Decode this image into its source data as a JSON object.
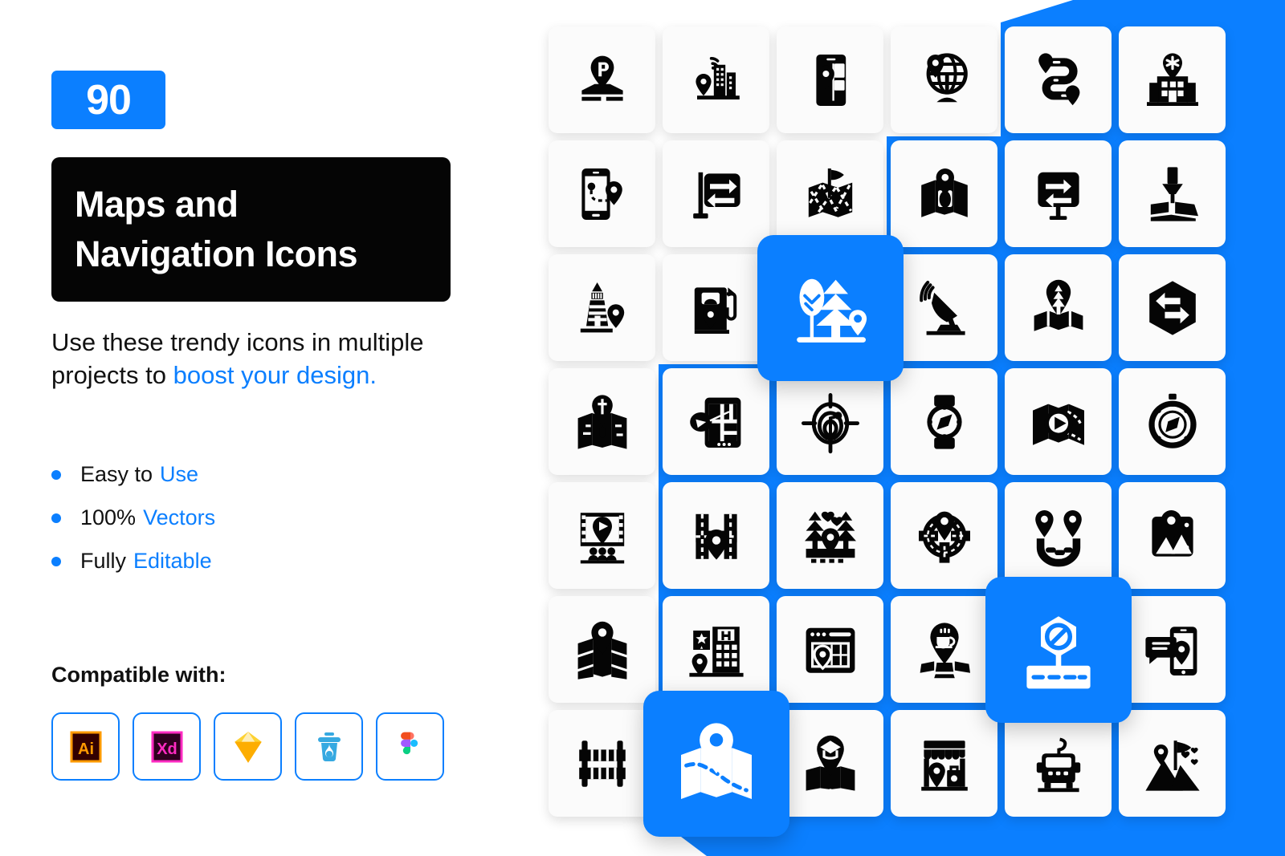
{
  "theme": {
    "accent": "#0b7fff",
    "dark": "#050505",
    "tile_bg": "#fbfbfb",
    "icon_color": "#050505",
    "page_bg": "#ffffff"
  },
  "left_panel": {
    "count_badge": "90",
    "title_lines": [
      "Maps and",
      "Navigation Icons"
    ],
    "description": {
      "part1": "Use these trendy icons in multiple projects to ",
      "highlight": "boost your design."
    },
    "bullets": [
      {
        "plain": "Easy to",
        "highlight": "Use"
      },
      {
        "plain": "100%",
        "highlight": "Vectors"
      },
      {
        "plain": "Fully",
        "highlight": "Editable"
      }
    ],
    "compatible_label": "Compatible with:",
    "compatible_apps": [
      {
        "name": "adobe-illustrator",
        "label": "Ai",
        "fg": "#ff9a00",
        "bg": "#330000"
      },
      {
        "name": "adobe-xd",
        "label": "Xd",
        "fg": "#ff2bc2",
        "bg": "#2e001f"
      },
      {
        "name": "sketch",
        "label": "",
        "fg": "#fdad00",
        "bg": "#ffffff"
      },
      {
        "name": "invision-studio",
        "label": "",
        "fg": "#36a9e1",
        "bg": "#ffffff"
      },
      {
        "name": "figma",
        "label": "",
        "fg": "#1abcfe",
        "bg": "#ffffff"
      }
    ]
  },
  "icon_grid": {
    "columns": 6,
    "rows": 7,
    "tiles": [
      {
        "row": 1,
        "col": 1,
        "icon": "parking-map-pin-icon",
        "label": "Parking on map"
      },
      {
        "row": 1,
        "col": 2,
        "icon": "city-signal-pin-icon",
        "label": "City location signal"
      },
      {
        "row": 1,
        "col": 3,
        "icon": "mobile-map-pin-icon",
        "label": "Mobile map pin"
      },
      {
        "row": 1,
        "col": 4,
        "icon": "globe-pin-icon",
        "label": "Globe with pin"
      },
      {
        "row": 1,
        "col": 5,
        "icon": "winding-route-icon",
        "label": "Winding route"
      },
      {
        "row": 1,
        "col": 6,
        "icon": "hospital-pin-icon",
        "label": "Hospital location"
      },
      {
        "row": 2,
        "col": 1,
        "icon": "phone-route-pin-icon",
        "label": "Phone navigation route"
      },
      {
        "row": 2,
        "col": 2,
        "icon": "two-way-signpost-icon",
        "label": "Two-way signpost"
      },
      {
        "row": 2,
        "col": 3,
        "icon": "flag-street-map-icon",
        "label": "Flag on street map"
      },
      {
        "row": 2,
        "col": 4,
        "icon": "map-pin-folded-icon",
        "label": "Folded map pin"
      },
      {
        "row": 2,
        "col": 5,
        "icon": "two-way-sign-board-icon",
        "label": "Two-way sign board"
      },
      {
        "row": 2,
        "col": 6,
        "icon": "pushpin-map-icon",
        "label": "Push pin on map"
      },
      {
        "row": 3,
        "col": 1,
        "icon": "lighthouse-pin-icon",
        "label": "Lighthouse location"
      },
      {
        "row": 3,
        "col": 2,
        "icon": "gas-station-pin-icon",
        "label": "Gas station location"
      },
      {
        "row": 3,
        "col": 3,
        "icon": "park-trees-pin-icon",
        "label": "Park location",
        "featured": true
      },
      {
        "row": 3,
        "col": 4,
        "icon": "satellite-dish-icon",
        "label": "Satellite dish"
      },
      {
        "row": 3,
        "col": 5,
        "icon": "forest-map-pin-icon",
        "label": "Forest on map"
      },
      {
        "row": 3,
        "col": 6,
        "icon": "two-way-arrow-hex-icon",
        "label": "Two-way arrows"
      },
      {
        "row": 4,
        "col": 1,
        "icon": "church-map-pin-icon",
        "label": "Church on map"
      },
      {
        "row": 4,
        "col": 2,
        "icon": "tablet-navigation-icon",
        "label": "Tablet navigation"
      },
      {
        "row": 4,
        "col": 3,
        "icon": "radar-target-icon",
        "label": "Radar target"
      },
      {
        "row": 4,
        "col": 4,
        "icon": "smartwatch-compass-icon",
        "label": "Smartwatch compass"
      },
      {
        "row": 4,
        "col": 5,
        "icon": "map-navigation-arrow-icon",
        "label": "Map navigation arrow"
      },
      {
        "row": 4,
        "col": 6,
        "icon": "compass-icon",
        "label": "Compass"
      },
      {
        "row": 5,
        "col": 1,
        "icon": "cinema-location-icon",
        "label": "Cinema location"
      },
      {
        "row": 5,
        "col": 2,
        "icon": "crossroad-pin-icon",
        "label": "Crossroad pin"
      },
      {
        "row": 5,
        "col": 3,
        "icon": "camp-forest-pin-icon",
        "label": "Camping forest pin"
      },
      {
        "row": 5,
        "col": 4,
        "icon": "roundabout-pin-icon",
        "label": "Roundabout pin"
      },
      {
        "row": 5,
        "col": 5,
        "icon": "two-pins-distance-icon",
        "label": "Distance between pins"
      },
      {
        "row": 5,
        "col": 6,
        "icon": "landscape-photo-pin-icon",
        "label": "Photo location"
      },
      {
        "row": 6,
        "col": 1,
        "icon": "folded-map-pin-icon",
        "label": "Folded map with pin"
      },
      {
        "row": 6,
        "col": 2,
        "icon": "hotel-pin-icon",
        "label": "Hotel location"
      },
      {
        "row": 6,
        "col": 3,
        "icon": "browser-map-icon",
        "label": "Map in browser"
      },
      {
        "row": 6,
        "col": 4,
        "icon": "cafe-pin-icon",
        "label": "Cafe location"
      },
      {
        "row": 6,
        "col": 5,
        "icon": "no-entry-road-sign-icon",
        "label": "No entry road sign",
        "featured": true
      },
      {
        "row": 6,
        "col": 6,
        "icon": "phone-chat-pin-icon",
        "label": "Phone chat location"
      },
      {
        "row": 7,
        "col": 1,
        "icon": "road-barrier-icon",
        "label": "Road barrier"
      },
      {
        "row": 7,
        "col": 2,
        "icon": "map-location-icon",
        "label": "Map location",
        "featured": true
      },
      {
        "row": 7,
        "col": 3,
        "icon": "university-pin-icon",
        "label": "University location"
      },
      {
        "row": 7,
        "col": 4,
        "icon": "shop-pin-icon",
        "label": "Shop location"
      },
      {
        "row": 7,
        "col": 5,
        "icon": "tram-front-icon",
        "label": "Tram"
      },
      {
        "row": 7,
        "col": 6,
        "icon": "mountain-flag-pin-icon",
        "label": "Mountain trail flag"
      }
    ]
  }
}
